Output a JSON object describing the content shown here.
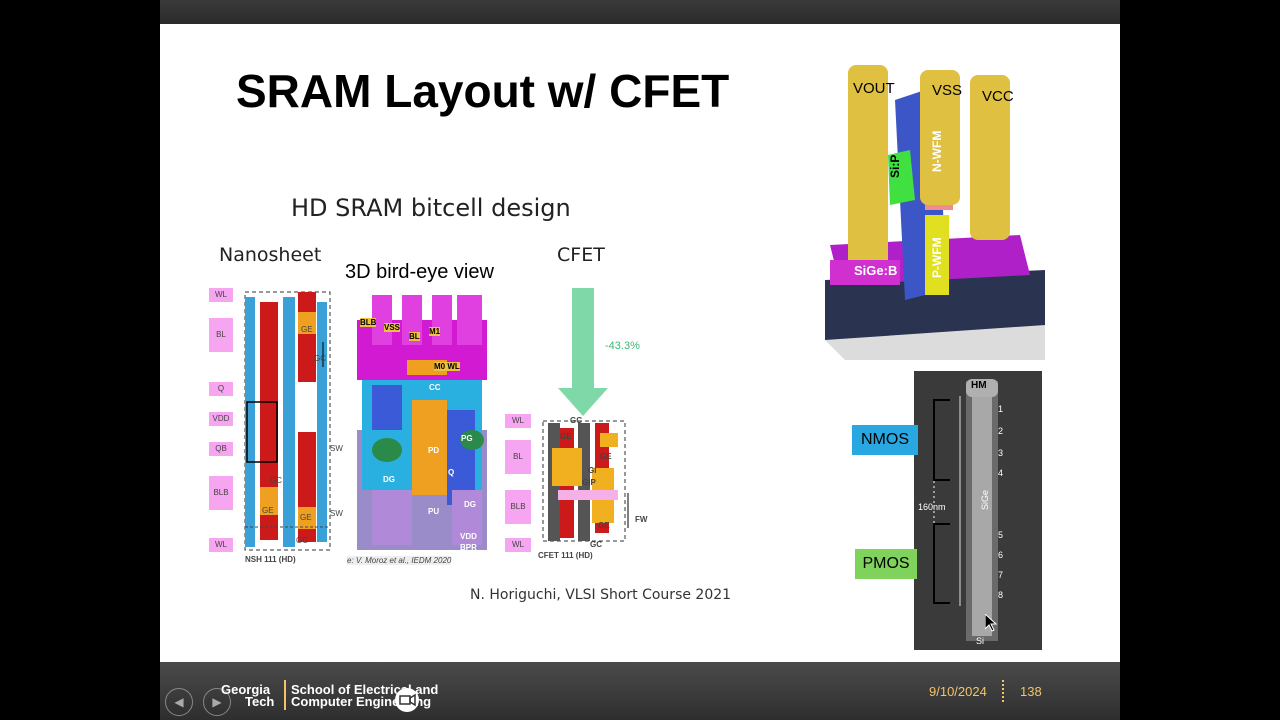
{
  "slide": {
    "title": "SRAM Layout w/ CFET",
    "figure_title": "HD SRAM bitcell design",
    "label_nanosheet": "Nanosheet",
    "label_birdeye": "3D bird-eye view",
    "label_cfet": "CFET",
    "reduction": "-43.3%",
    "nsh_caption": "NSH 111 (HD)",
    "cfet_caption": "CFET 111 (HD)",
    "birdeye_source": "e: V. Moroz et al., IEDM 2020",
    "credit": "N. Horiguchi, VLSI Short Course 2021",
    "left_labels": [
      "WL",
      "BL",
      "Q",
      "VDD",
      "QB",
      "BLB",
      "WL"
    ],
    "cfet_left_labels": [
      "WL",
      "BL",
      "BLB",
      "WL"
    ],
    "birdeye_tags": [
      "BLB",
      "VSS",
      "M1",
      "BL",
      "M0 WL",
      "CC",
      "PD",
      "PG",
      "Q",
      "DG",
      "DG",
      "PU",
      "VDD",
      "BPR"
    ],
    "nsh_tags": [
      "GE",
      "GC",
      "SW",
      "SW",
      "GC",
      "GE",
      "GE",
      "GC"
    ],
    "cfet_tags": [
      "GE",
      "GE",
      "GI",
      "GIP",
      "GE",
      "FW",
      "GC",
      "GC"
    ],
    "cfet3d": {
      "vout": "VOUT",
      "vss": "VSS",
      "vcc": "VCC",
      "sip": "Si:P",
      "nwfm": "N-WFM",
      "pwfm": "P-WFM",
      "sigeb": "SiGe:B"
    },
    "tem": {
      "hm": "HM",
      "numbers": [
        "1",
        "2",
        "3",
        "4",
        "5",
        "6",
        "7",
        "8"
      ],
      "sige": "SiGe",
      "si": "Si",
      "dimension": "160nm",
      "nmos": "NMOS",
      "pmos": "PMOS"
    }
  },
  "footer": {
    "logo_line1": "Georgia",
    "logo_line2": "Tech",
    "school_line1": "School of Electrical and",
    "school_line2": "Computer Engineering",
    "date": "9/10/2024",
    "page": "138",
    "prev": "◀",
    "next": "▶"
  },
  "colors": {
    "accent_gold": "#f2c36b",
    "nmos_badge": "#29a7e1",
    "pmos_badge": "#7fd35c",
    "gate_red": "#cc1a1a",
    "magenta": "#d11ad1",
    "blue": "#3a8fd8"
  }
}
